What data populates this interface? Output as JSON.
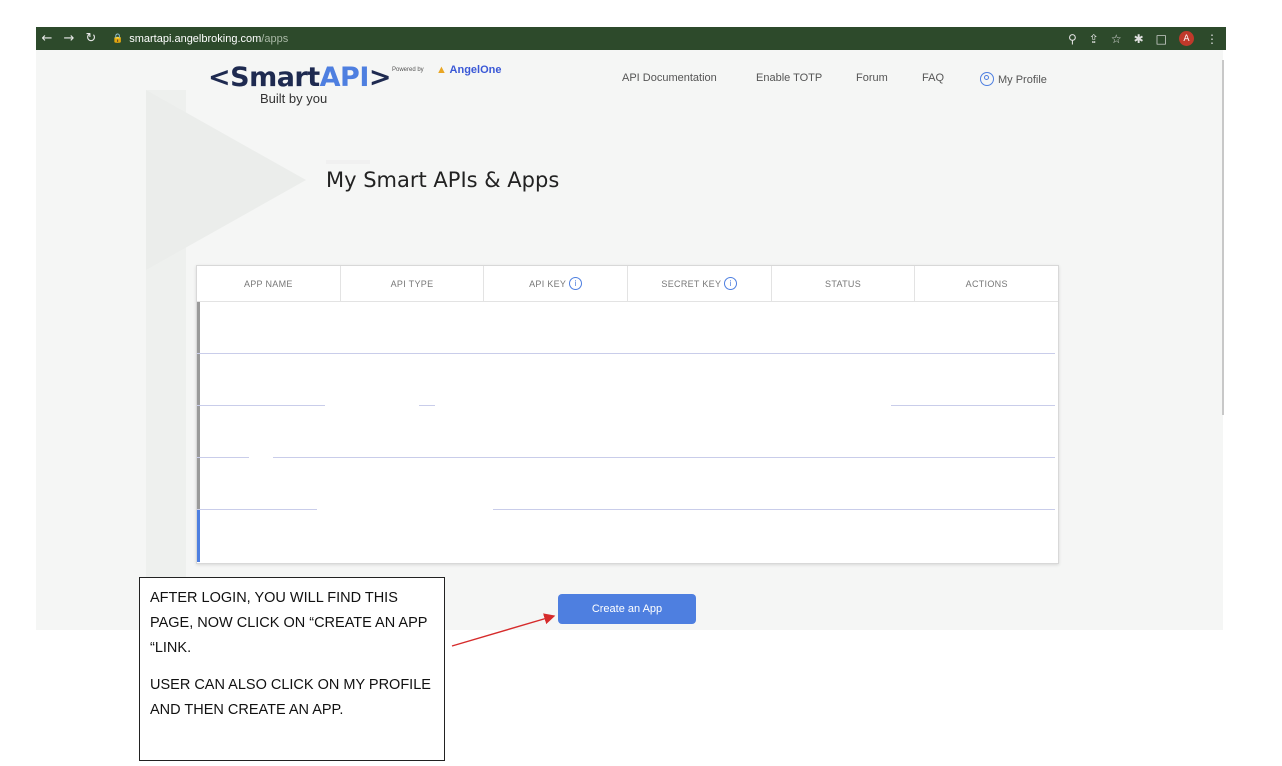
{
  "browser": {
    "url_host": "smartapi.angelbroking.com",
    "url_path": "/apps",
    "avatar_letter": "A"
  },
  "header": {
    "logo_prefix": "<Smart",
    "logo_accent": "API",
    "logo_suffix": ">",
    "tagline": "Built by you",
    "powered_by": "Powered by",
    "partner": "AngelOne",
    "nav": {
      "api_docs": "API Documentation",
      "enable_totp": "Enable TOTP",
      "forum": "Forum",
      "faq": "FAQ",
      "my_profile": "My Profile"
    }
  },
  "main": {
    "title": "My Smart APIs & Apps",
    "table": {
      "columns": [
        "APP NAME",
        "API TYPE",
        "API KEY",
        "SECRET KEY",
        "STATUS",
        "ACTIONS"
      ]
    },
    "create_button": "Create an App"
  },
  "annotation": {
    "line1": "AFTER LOGIN, YOU WILL FIND THIS PAGE, NOW CLICK ON “CREATE AN APP “LINK.",
    "line2": "USER CAN ALSO CLICK ON MY PROFILE AND THEN CREATE AN APP."
  },
  "colors": {
    "accent": "#4e7fe0",
    "browser_bar": "#2d4a2b",
    "arrow": "#d62b2b"
  }
}
